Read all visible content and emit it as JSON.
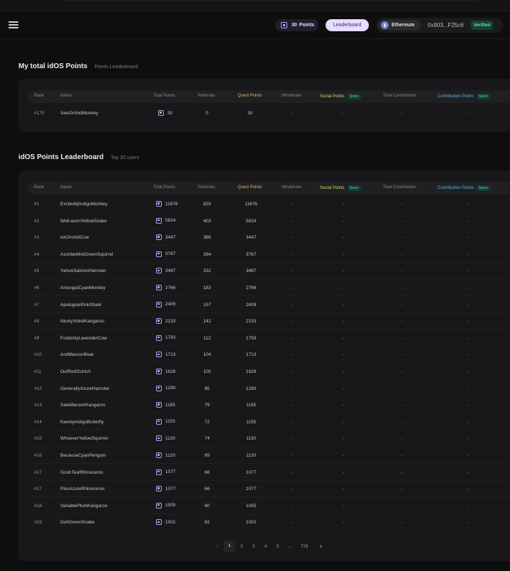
{
  "header": {
    "points_value": "30",
    "points_label": "Points",
    "leaderboard_label": "Leaderboard",
    "network": "Ethereum",
    "address": "0x903...F25c6",
    "verified": "Verified"
  },
  "columns": {
    "rank": "Rank",
    "name": "Name",
    "total_points": "Total Points",
    "referrals": "Referrals",
    "quest_points": "Quest Points",
    "mindshare": "Mindshare",
    "social_points": "Social Points",
    "total_contribution": "Total Contribution",
    "contribution_points": "Contribution Points",
    "soon": "Soon"
  },
  "my_points": {
    "title": "My total idOS Points",
    "subtitle": "Points Leaderboard",
    "row": {
      "rank": "#170",
      "name": "SeeOrchidMonkey",
      "total": "30",
      "referrals": "0",
      "quest": "30",
      "mindshare": "-",
      "social": "-",
      "contribution": "-",
      "contribution_points": "-"
    }
  },
  "leaderboard": {
    "title": "idOS Points Leaderboard",
    "subtitle": "Top 20 users",
    "rows": [
      {
        "rank": "#1",
        "name": "ExcitedlyIndigoMonkey",
        "total": "11676",
        "referrals": "829",
        "quest": "11676"
      },
      {
        "rank": "#2",
        "name": "Well-wornYellowSnake",
        "total": "5824",
        "referrals": "403",
        "quest": "5824"
      },
      {
        "rank": "#3",
        "name": "IckOrchidCow",
        "total": "3447",
        "referrals": "386",
        "quest": "3447"
      },
      {
        "rank": "#4",
        "name": "AscribeMintGreenSquirrel",
        "total": "3767",
        "referrals": "264",
        "quest": "3767"
      },
      {
        "rank": "#5",
        "name": "YahooSalmonHamster",
        "total": "3467",
        "referrals": "232",
        "quest": "3467"
      },
      {
        "rank": "#6",
        "name": "AmongstCyanMonkey",
        "total": "2766",
        "referrals": "183",
        "quest": "2766"
      },
      {
        "rank": "#7",
        "name": "ApologisePinkShark",
        "total": "2409",
        "referrals": "157",
        "quest": "2409"
      },
      {
        "rank": "#8",
        "name": "NicelyVioletKangaroo",
        "total": "2233",
        "referrals": "142",
        "quest": "2233"
      },
      {
        "rank": "#9",
        "name": "FoolishlyLavenderCow",
        "total": "1793",
        "referrals": "112",
        "quest": "1793"
      },
      {
        "rank": "#10",
        "name": "AndMaroonBear",
        "total": "1713",
        "referrals": "104",
        "quest": "1713"
      },
      {
        "rank": "#11",
        "name": "OutRedOstrich",
        "total": "1628",
        "referrals": "100",
        "quest": "1628"
      },
      {
        "rank": "#12",
        "name": "GenerallyAzureHamster",
        "total": "1290",
        "referrals": "85",
        "quest": "1290"
      },
      {
        "rank": "#13",
        "name": "SateMaroonKangaroo",
        "total": "1165",
        "referrals": "79",
        "quest": "1165"
      },
      {
        "rank": "#14",
        "name": "KeenlyIndigoButterfly",
        "total": "1155",
        "referrals": "72",
        "quest": "1155"
      },
      {
        "rank": "#15",
        "name": "WhoeverYellowSquirrel",
        "total": "1130",
        "referrals": "74",
        "quest": "1130"
      },
      {
        "rank": "#16",
        "name": "BecauseCyanPenguin",
        "total": "1120",
        "referrals": "69",
        "quest": "1120"
      },
      {
        "rank": "#17",
        "name": "GoshTealRhinoceros",
        "total": "1077",
        "referrals": "66",
        "quest": "1077"
      },
      {
        "rank": "#17",
        "name": "PlusAzureRhinoceros",
        "total": "1077",
        "referrals": "66",
        "quest": "1077"
      },
      {
        "rank": "#18",
        "name": "VariablePlumKangaroo",
        "total": "1005",
        "referrals": "60",
        "quest": "1005"
      },
      {
        "rank": "#19",
        "name": "DuhGreenSnake",
        "total": "1002",
        "referrals": "62",
        "quest": "1002"
      }
    ],
    "placeholder": "-"
  },
  "pagination": {
    "pages": [
      "1",
      "2",
      "3",
      "4",
      "5",
      "...",
      "728"
    ],
    "current": "1",
    "prev_icon": "‹",
    "next_icon": "›"
  },
  "colors": {
    "accent": "#b7a2f5",
    "leaderboard_button": "#e6dcff",
    "quest": "#e0b56b",
    "social": "#b9e25d",
    "contribution": "#5eb6e6",
    "verified": "#5fe0a3"
  }
}
